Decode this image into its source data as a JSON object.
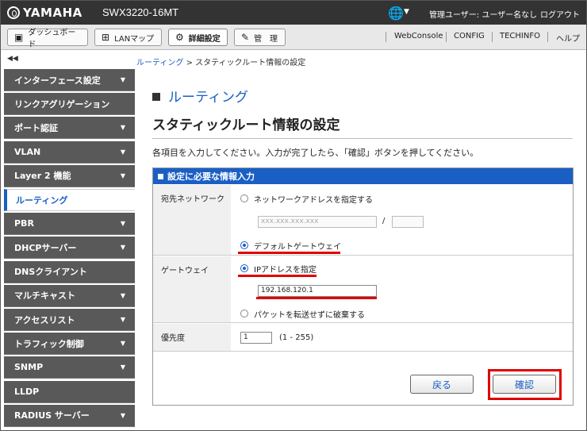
{
  "header": {
    "brand": "YAMAHA",
    "model": "SWX3220-16MT",
    "user_info": "管理ユーザー: ユーザー名なし",
    "logout": "ログアウト"
  },
  "toolbar": {
    "dashboard": "ダッシュボード",
    "lanmap": "LANマップ",
    "detail": "詳細設定",
    "admin": "管　理",
    "links": [
      "WebConsole",
      "CONFIG",
      "TECHINFO",
      "ヘルプ"
    ]
  },
  "sidebar": {
    "collapse": "◀◀",
    "items": [
      {
        "label": "インターフェース設定",
        "caret": true
      },
      {
        "label": "リンクアグリゲーション",
        "caret": false
      },
      {
        "label": "ポート認証",
        "caret": true
      },
      {
        "label": "VLAN",
        "caret": true
      },
      {
        "label": "Layer 2 機能",
        "caret": true
      },
      {
        "label": "ルーティング",
        "caret": false,
        "active": true
      },
      {
        "label": "PBR",
        "caret": true
      },
      {
        "label": "DHCPサーバー",
        "caret": true
      },
      {
        "label": "DNSクライアント",
        "caret": false
      },
      {
        "label": "マルチキャスト",
        "caret": true
      },
      {
        "label": "アクセスリスト",
        "caret": true
      },
      {
        "label": "トラフィック制御",
        "caret": true
      },
      {
        "label": "SNMP",
        "caret": true
      },
      {
        "label": "LLDP",
        "caret": false
      },
      {
        "label": "RADIUS サーバー",
        "caret": true
      }
    ]
  },
  "breadcrumb": {
    "link": "ルーティング",
    "sep": " > ",
    "current": "スタティックルート情報の設定"
  },
  "main": {
    "section_title": "ルーティング",
    "page_title": "スタティックルート情報の設定",
    "instruction": "各項目を入力してください。入力が完了したら、「確認」ボタンを押してください。",
    "panel_title": "設定に必要な情報入力",
    "destination": {
      "label": "宛先ネットワーク",
      "option_network": "ネットワークアドレスを指定する",
      "network_placeholder": "xxx.xxx.xxx.xxx",
      "slash": "/",
      "option_default": "デフォルトゲートウェイ",
      "selected": "default"
    },
    "gateway": {
      "label": "ゲートウェイ",
      "option_ip": "IPアドレスを指定",
      "ip_value": "192.168.120.1",
      "option_discard": "パケットを転送せずに破棄する",
      "selected": "ip"
    },
    "priority": {
      "label": "優先度",
      "value": "1",
      "range": "(1 - 255)"
    },
    "back_button": "戻る",
    "confirm_button": "確認"
  },
  "colors": {
    "accent": "#1a5fc4",
    "highlight": "#e00000",
    "sidebar": "#595959",
    "topbar": "#333333"
  }
}
